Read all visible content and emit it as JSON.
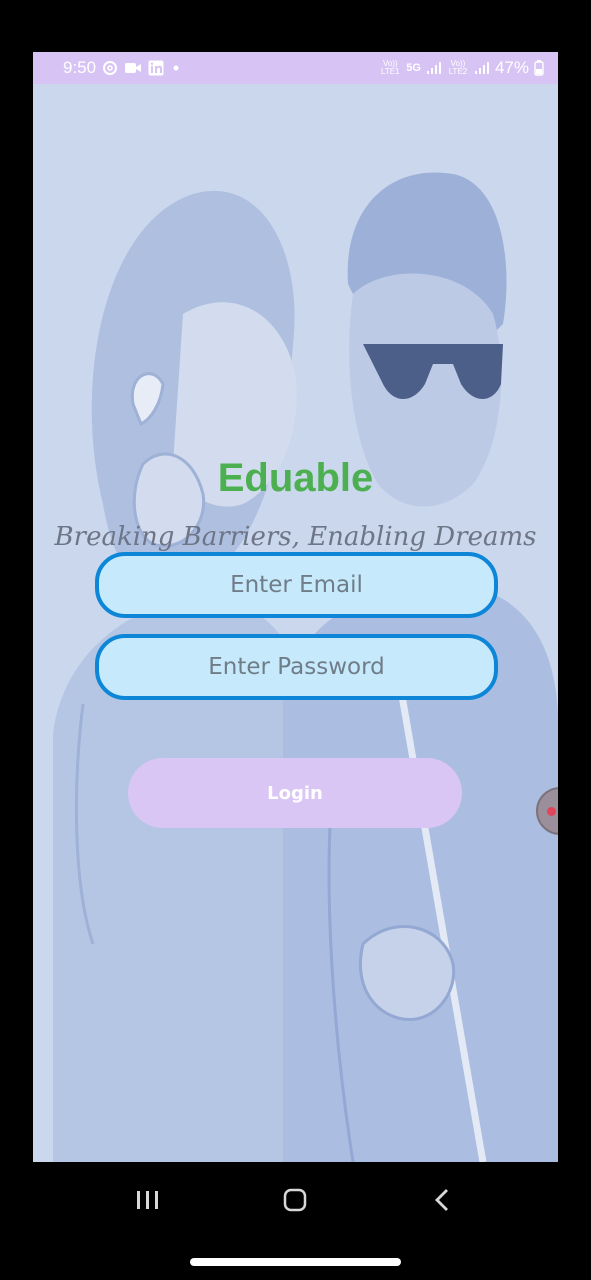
{
  "status_bar": {
    "time": "9:50",
    "left_icons": [
      "threads-icon",
      "video-icon",
      "linkedin-icon",
      "dot-icon"
    ],
    "network_1_label": "Vo)) LTE1",
    "network_badge": "5G",
    "network_2_label": "Vo)) LTE2",
    "battery": "47%"
  },
  "app": {
    "title": "Eduable",
    "tagline": "Breaking Barriers, Enabling Dreams",
    "email_placeholder": "Enter Email",
    "email_value": "",
    "password_placeholder": "Enter Password",
    "password_value": "",
    "login_label": "Login",
    "colors": {
      "title": "#4caf50",
      "field_border": "#0d86d8",
      "field_fill": "#c6e9fc",
      "button_fill": "#d9c6f4",
      "status_bar": "#d7c4f4"
    }
  },
  "nav": {
    "buttons": [
      "recents-icon",
      "home-icon",
      "back-icon"
    ]
  }
}
